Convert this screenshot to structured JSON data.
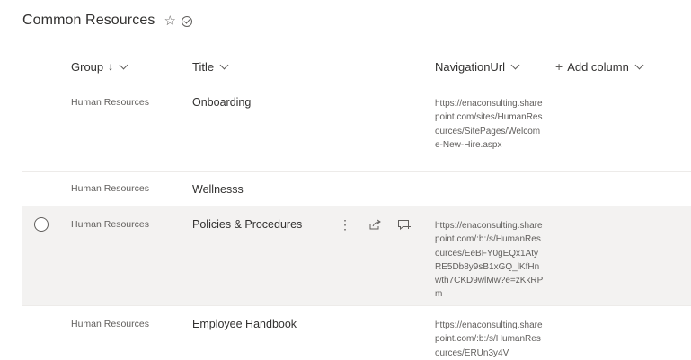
{
  "list": {
    "title": "Common Resources",
    "star_icon": "☆"
  },
  "columns": {
    "group": "Group",
    "group_sort": "↓",
    "title": "Title",
    "navigation_url": "NavigationUrl",
    "add_column": "Add column",
    "add_icon": "+"
  },
  "rows": [
    {
      "group": "Human Resources",
      "title": "Onboarding",
      "url": "https://enaconsulting.sharepoint.com/sites/HumanResources/SitePages/Welcome-New-Hire.aspx"
    },
    {
      "group": "Human Resources",
      "title": "Wellnesss",
      "url": ""
    },
    {
      "group": "Human Resources",
      "title": "Policies & Procedures",
      "url": "https://enaconsulting.sharepoint.com/:b:/s/HumanResources/EeBFY0gEQx1AtyRE5Db8y9sB1xGQ_lKfHnwth7CKD9wlMw?e=zKkRPm",
      "selected": true
    },
    {
      "group": "Human Resources",
      "title": "Employee Handbook",
      "url": "https://enaconsulting.sharepoint.com/:b:/s/HumanResources/ERUn3y4V"
    }
  ],
  "row_actions": {
    "more_icon": "⋮"
  }
}
